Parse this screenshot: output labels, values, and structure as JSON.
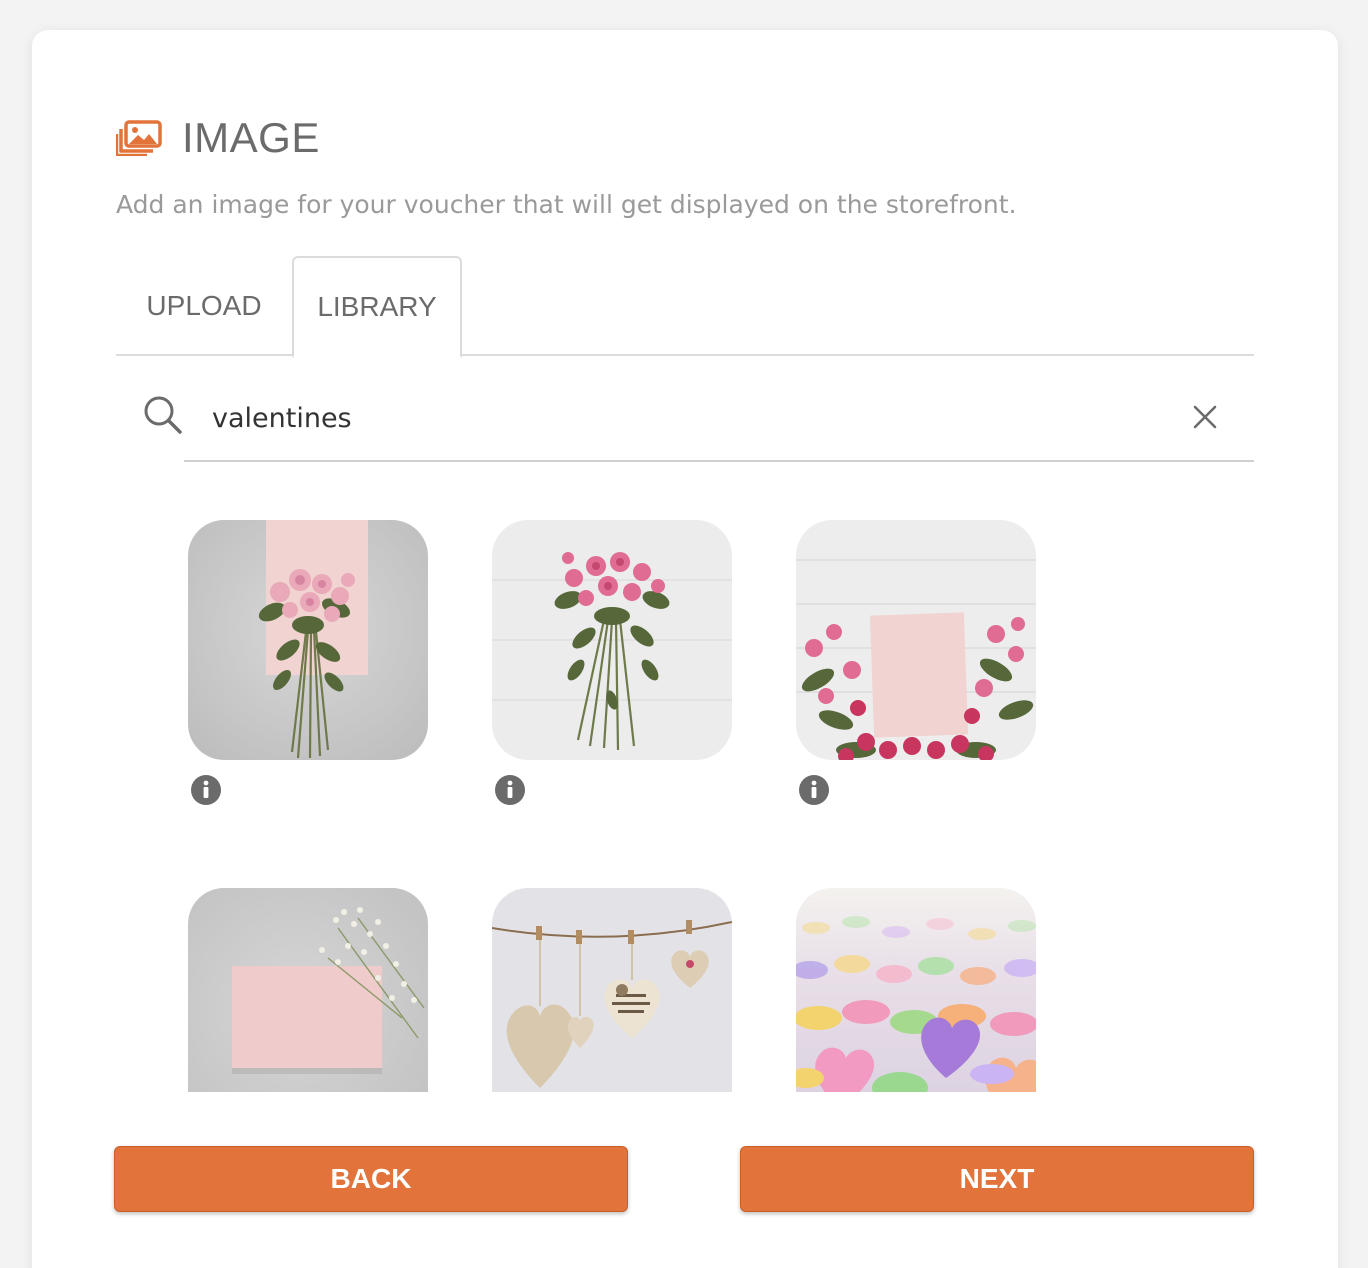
{
  "header": {
    "icon": "image-gallery-icon",
    "title": "IMAGE",
    "subtitle": "Add an image for your voucher that will get displayed on the storefront."
  },
  "tabs": [
    {
      "label": "UPLOAD",
      "active": false
    },
    {
      "label": "LIBRARY",
      "active": true
    }
  ],
  "search": {
    "value": "valentines",
    "icon": "search-icon",
    "clear_icon": "close-icon"
  },
  "library": {
    "images": [
      {
        "subject": "pink roses bouquet on card over grey stone",
        "info_icon": "info-icon"
      },
      {
        "subject": "pink roses bouquet on white wood",
        "info_icon": "info-icon"
      },
      {
        "subject": "blank card framed by pink roses",
        "info_icon": "info-icon"
      },
      {
        "subject": "blank pink card with baby's breath",
        "info_icon": ""
      },
      {
        "subject": "fabric hearts hanging on twine",
        "info_icon": ""
      },
      {
        "subject": "candy conversation hearts",
        "info_icon": ""
      }
    ]
  },
  "actions": {
    "back_label": "BACK",
    "next_label": "NEXT"
  },
  "colors": {
    "accent": "#e2733a",
    "title": "#6b6b6b",
    "subtitle": "#9a9a9a",
    "divider": "#dcdcdc"
  }
}
